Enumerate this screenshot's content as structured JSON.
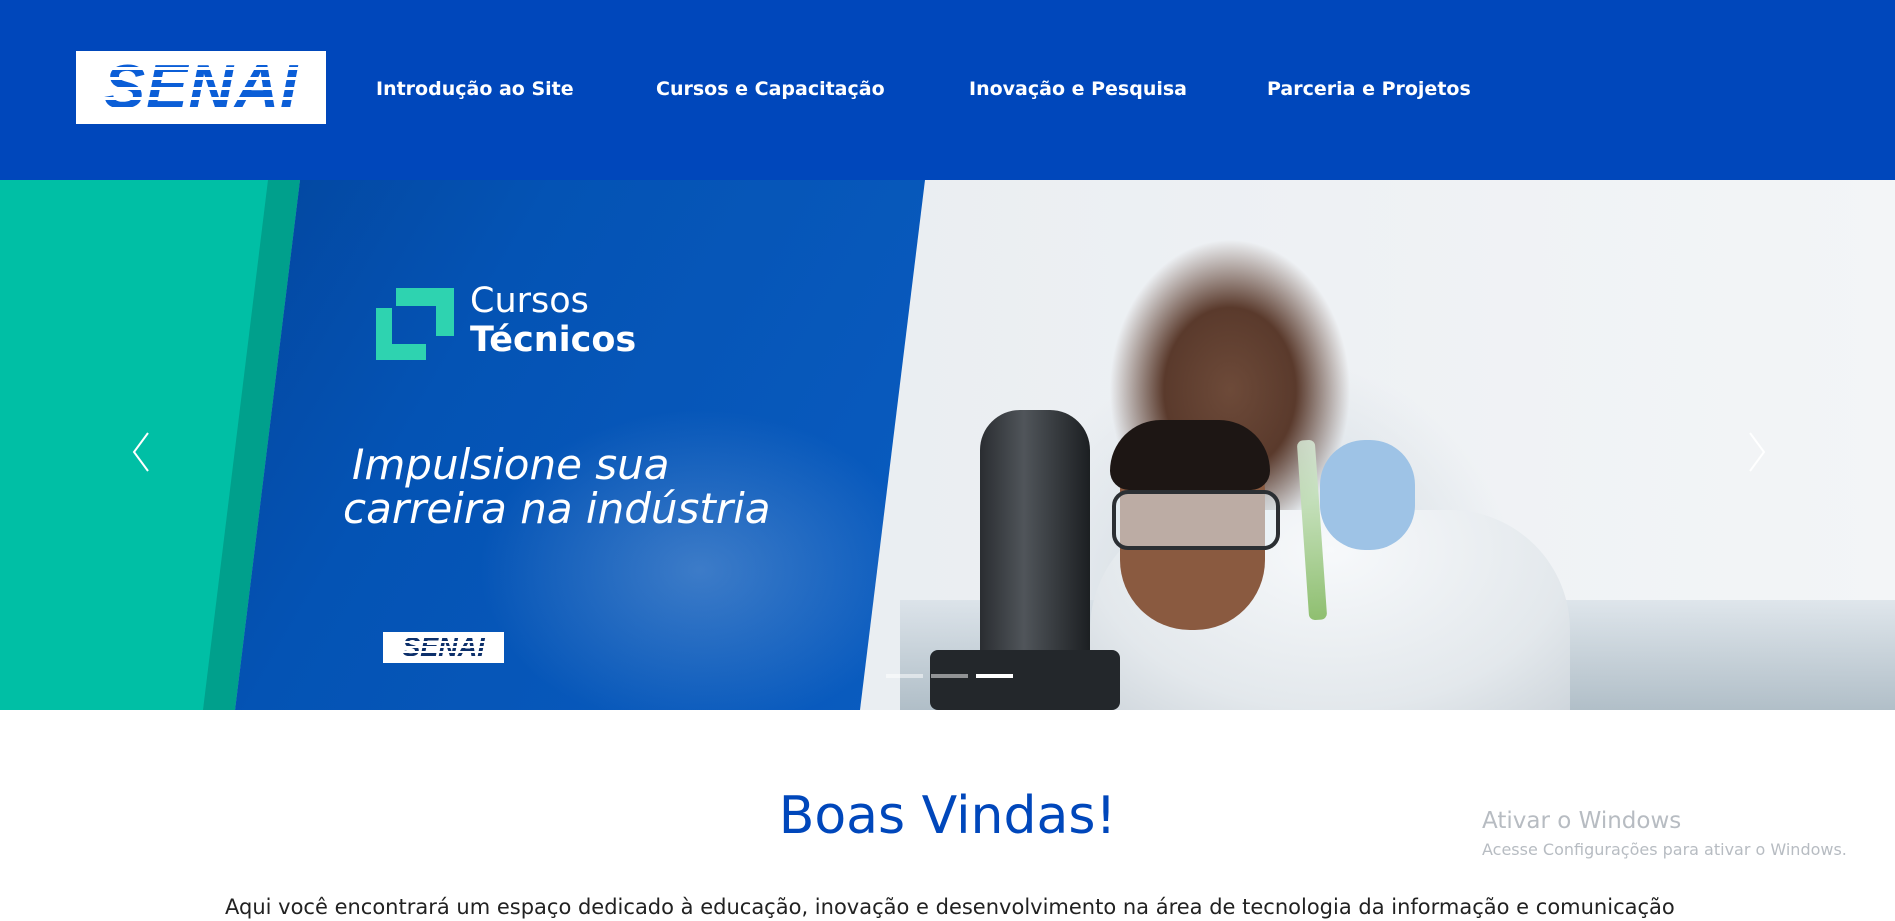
{
  "brand": {
    "logo_text": "SENAI",
    "color_primary": "#0047bb",
    "color_teal": "#00bfa5"
  },
  "nav": {
    "items": [
      {
        "label": "Introdução ao Site"
      },
      {
        "label": "Cursos e Capacitação"
      },
      {
        "label": "Inovação e Pesquisa"
      },
      {
        "label": "Parceria e Projetos"
      }
    ]
  },
  "carousel": {
    "slide": {
      "heading_line1": "Cursos",
      "heading_line2": "Técnicos",
      "tagline_line1": "Impulsione sua",
      "tagline_line2": "carreira na indústria",
      "logo_text": "SENAI"
    },
    "prev_icon": "chevron-left-icon",
    "next_icon": "chevron-right-icon",
    "indicator_count": 3,
    "active_index": 2
  },
  "main": {
    "title": "Boas Vindas!",
    "intro": "Aqui você encontrará um espaço dedicado à educação, inovação e desenvolvimento na área de tecnologia da informação e comunicação."
  },
  "watermark": {
    "title": "Ativar o Windows",
    "subtitle": "Acesse Configurações para ativar o Windows."
  }
}
